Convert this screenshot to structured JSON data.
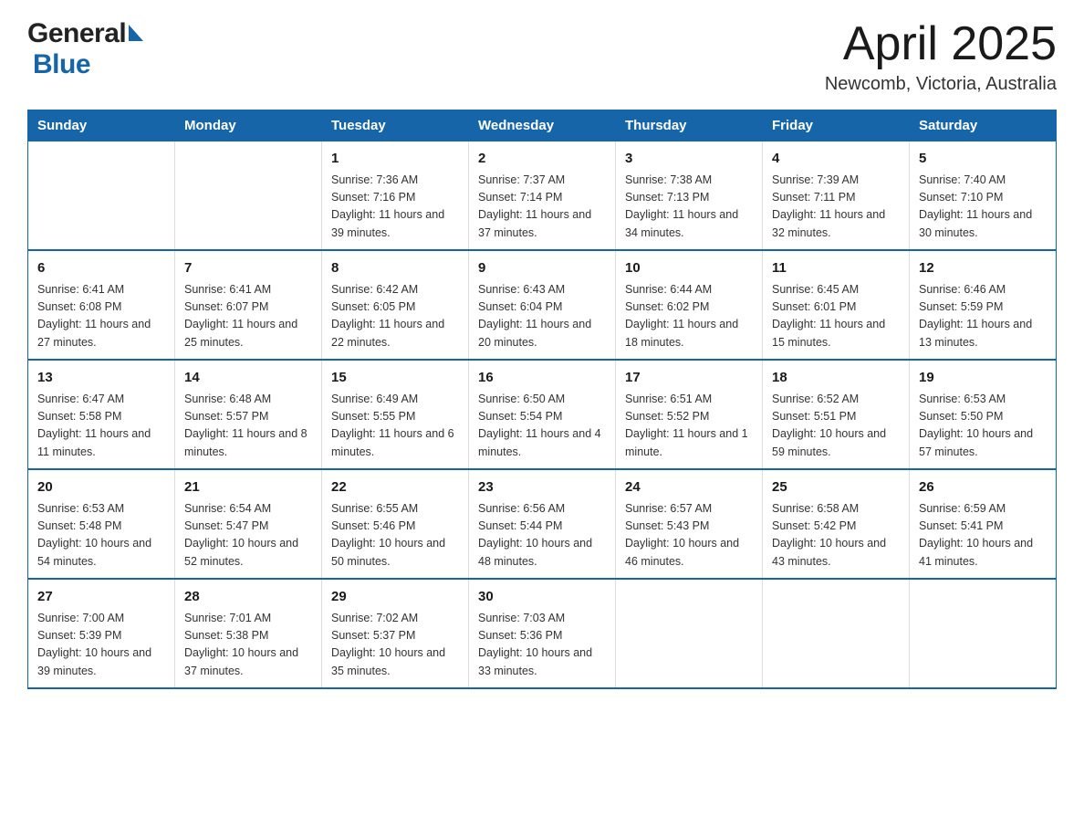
{
  "header": {
    "logo_general": "General",
    "logo_blue": "Blue",
    "title": "April 2025",
    "subtitle": "Newcomb, Victoria, Australia"
  },
  "days_of_week": [
    "Sunday",
    "Monday",
    "Tuesday",
    "Wednesday",
    "Thursday",
    "Friday",
    "Saturday"
  ],
  "weeks": [
    [
      {
        "day": "",
        "info": ""
      },
      {
        "day": "",
        "info": ""
      },
      {
        "day": "1",
        "info": "Sunrise: 7:36 AM\nSunset: 7:16 PM\nDaylight: 11 hours\nand 39 minutes."
      },
      {
        "day": "2",
        "info": "Sunrise: 7:37 AM\nSunset: 7:14 PM\nDaylight: 11 hours\nand 37 minutes."
      },
      {
        "day": "3",
        "info": "Sunrise: 7:38 AM\nSunset: 7:13 PM\nDaylight: 11 hours\nand 34 minutes."
      },
      {
        "day": "4",
        "info": "Sunrise: 7:39 AM\nSunset: 7:11 PM\nDaylight: 11 hours\nand 32 minutes."
      },
      {
        "day": "5",
        "info": "Sunrise: 7:40 AM\nSunset: 7:10 PM\nDaylight: 11 hours\nand 30 minutes."
      }
    ],
    [
      {
        "day": "6",
        "info": "Sunrise: 6:41 AM\nSunset: 6:08 PM\nDaylight: 11 hours\nand 27 minutes."
      },
      {
        "day": "7",
        "info": "Sunrise: 6:41 AM\nSunset: 6:07 PM\nDaylight: 11 hours\nand 25 minutes."
      },
      {
        "day": "8",
        "info": "Sunrise: 6:42 AM\nSunset: 6:05 PM\nDaylight: 11 hours\nand 22 minutes."
      },
      {
        "day": "9",
        "info": "Sunrise: 6:43 AM\nSunset: 6:04 PM\nDaylight: 11 hours\nand 20 minutes."
      },
      {
        "day": "10",
        "info": "Sunrise: 6:44 AM\nSunset: 6:02 PM\nDaylight: 11 hours\nand 18 minutes."
      },
      {
        "day": "11",
        "info": "Sunrise: 6:45 AM\nSunset: 6:01 PM\nDaylight: 11 hours\nand 15 minutes."
      },
      {
        "day": "12",
        "info": "Sunrise: 6:46 AM\nSunset: 5:59 PM\nDaylight: 11 hours\nand 13 minutes."
      }
    ],
    [
      {
        "day": "13",
        "info": "Sunrise: 6:47 AM\nSunset: 5:58 PM\nDaylight: 11 hours\nand 11 minutes."
      },
      {
        "day": "14",
        "info": "Sunrise: 6:48 AM\nSunset: 5:57 PM\nDaylight: 11 hours\nand 8 minutes."
      },
      {
        "day": "15",
        "info": "Sunrise: 6:49 AM\nSunset: 5:55 PM\nDaylight: 11 hours\nand 6 minutes."
      },
      {
        "day": "16",
        "info": "Sunrise: 6:50 AM\nSunset: 5:54 PM\nDaylight: 11 hours\nand 4 minutes."
      },
      {
        "day": "17",
        "info": "Sunrise: 6:51 AM\nSunset: 5:52 PM\nDaylight: 11 hours\nand 1 minute."
      },
      {
        "day": "18",
        "info": "Sunrise: 6:52 AM\nSunset: 5:51 PM\nDaylight: 10 hours\nand 59 minutes."
      },
      {
        "day": "19",
        "info": "Sunrise: 6:53 AM\nSunset: 5:50 PM\nDaylight: 10 hours\nand 57 minutes."
      }
    ],
    [
      {
        "day": "20",
        "info": "Sunrise: 6:53 AM\nSunset: 5:48 PM\nDaylight: 10 hours\nand 54 minutes."
      },
      {
        "day": "21",
        "info": "Sunrise: 6:54 AM\nSunset: 5:47 PM\nDaylight: 10 hours\nand 52 minutes."
      },
      {
        "day": "22",
        "info": "Sunrise: 6:55 AM\nSunset: 5:46 PM\nDaylight: 10 hours\nand 50 minutes."
      },
      {
        "day": "23",
        "info": "Sunrise: 6:56 AM\nSunset: 5:44 PM\nDaylight: 10 hours\nand 48 minutes."
      },
      {
        "day": "24",
        "info": "Sunrise: 6:57 AM\nSunset: 5:43 PM\nDaylight: 10 hours\nand 46 minutes."
      },
      {
        "day": "25",
        "info": "Sunrise: 6:58 AM\nSunset: 5:42 PM\nDaylight: 10 hours\nand 43 minutes."
      },
      {
        "day": "26",
        "info": "Sunrise: 6:59 AM\nSunset: 5:41 PM\nDaylight: 10 hours\nand 41 minutes."
      }
    ],
    [
      {
        "day": "27",
        "info": "Sunrise: 7:00 AM\nSunset: 5:39 PM\nDaylight: 10 hours\nand 39 minutes."
      },
      {
        "day": "28",
        "info": "Sunrise: 7:01 AM\nSunset: 5:38 PM\nDaylight: 10 hours\nand 37 minutes."
      },
      {
        "day": "29",
        "info": "Sunrise: 7:02 AM\nSunset: 5:37 PM\nDaylight: 10 hours\nand 35 minutes."
      },
      {
        "day": "30",
        "info": "Sunrise: 7:03 AM\nSunset: 5:36 PM\nDaylight: 10 hours\nand 33 minutes."
      },
      {
        "day": "",
        "info": ""
      },
      {
        "day": "",
        "info": ""
      },
      {
        "day": "",
        "info": ""
      }
    ]
  ]
}
